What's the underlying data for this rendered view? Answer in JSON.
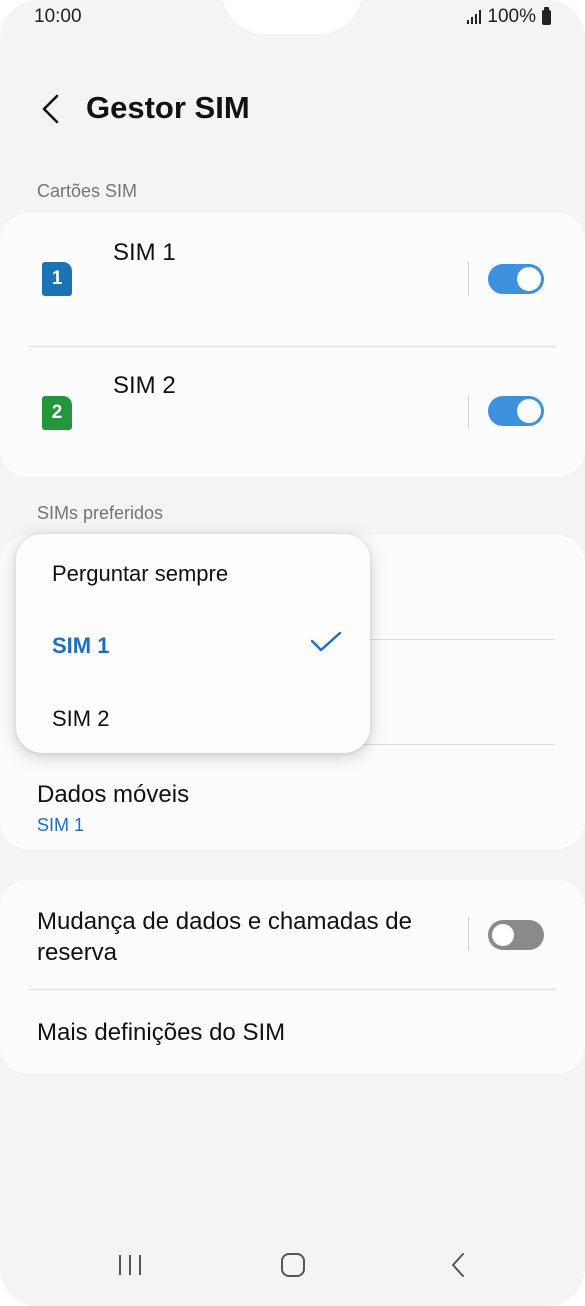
{
  "status_bar": {
    "time": "10:00",
    "battery": "100%"
  },
  "header": {
    "title": "Gestor SIM"
  },
  "sections": {
    "sim_cards": "Cartões SIM",
    "preferred": "SIMs preferidos"
  },
  "sim_cards": [
    {
      "name": "SIM 1",
      "badge": "1",
      "color": "#1a73b2",
      "enabled": true
    },
    {
      "name": "SIM 2",
      "badge": "2",
      "color": "#22973b",
      "enabled": true
    }
  ],
  "preferred": {
    "mobile_data_label": "Dados móveis",
    "mobile_data_value": "SIM 1"
  },
  "dropdown": {
    "options": [
      "Perguntar sempre",
      "SIM 1",
      "SIM 2"
    ],
    "selected": "SIM 1"
  },
  "extra": {
    "backup_label": "Mudança de dados e chamadas de reserva",
    "backup_enabled": false,
    "more_label": "Mais definições do SIM"
  },
  "colors": {
    "accent": "#3e91dd",
    "link": "#1f6fc0"
  }
}
